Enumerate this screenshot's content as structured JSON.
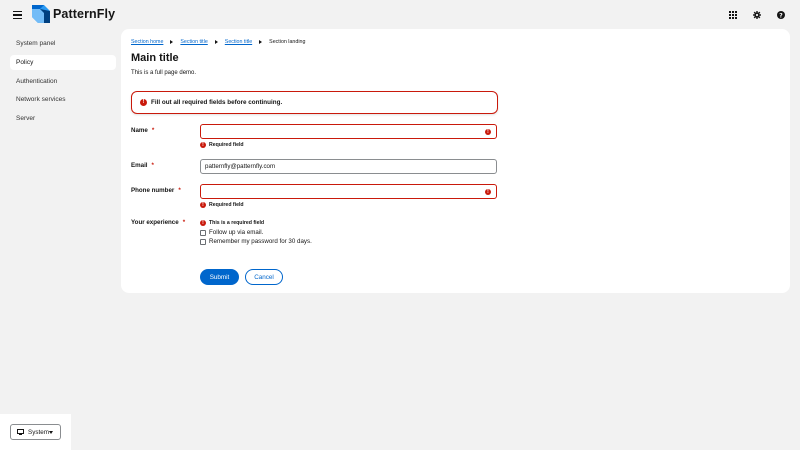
{
  "header": {
    "brand_name": "PatternFly",
    "tools": [
      "apps-grid-icon",
      "gear-icon",
      "help-icon"
    ]
  },
  "sidebar": {
    "items": [
      {
        "label": "System panel",
        "active": false
      },
      {
        "label": "Policy",
        "active": true
      },
      {
        "label": "Authentication",
        "active": false
      },
      {
        "label": "Network services",
        "active": false
      },
      {
        "label": "Server",
        "active": false
      }
    ],
    "theme_select": {
      "label": "System",
      "icon": "monitor-icon"
    }
  },
  "breadcrumb": {
    "items": [
      "Section home",
      "Section title",
      "Section title"
    ],
    "current": "Section landing"
  },
  "page": {
    "title": "Main title",
    "description": "This is a full page demo."
  },
  "alert": {
    "text": "Fill out all required fields before continuing."
  },
  "form": {
    "name": {
      "label": "Name",
      "required": "*",
      "value": "",
      "helper": "Required field"
    },
    "email": {
      "label": "Email",
      "required": "*",
      "value": "patternfly@patternfly.com"
    },
    "phone": {
      "label": "Phone number",
      "required": "*",
      "value": "",
      "helper": "Required field"
    },
    "experience": {
      "label": "Your experience",
      "required": "*",
      "helper": "This is a required field",
      "options": [
        "Follow up via email.",
        "Remember my password for 30 days."
      ]
    },
    "submit_label": "Submit",
    "cancel_label": "Cancel"
  },
  "colors": {
    "accent": "#0066cc",
    "danger": "#c9190b",
    "background": "#f2f2f2"
  }
}
